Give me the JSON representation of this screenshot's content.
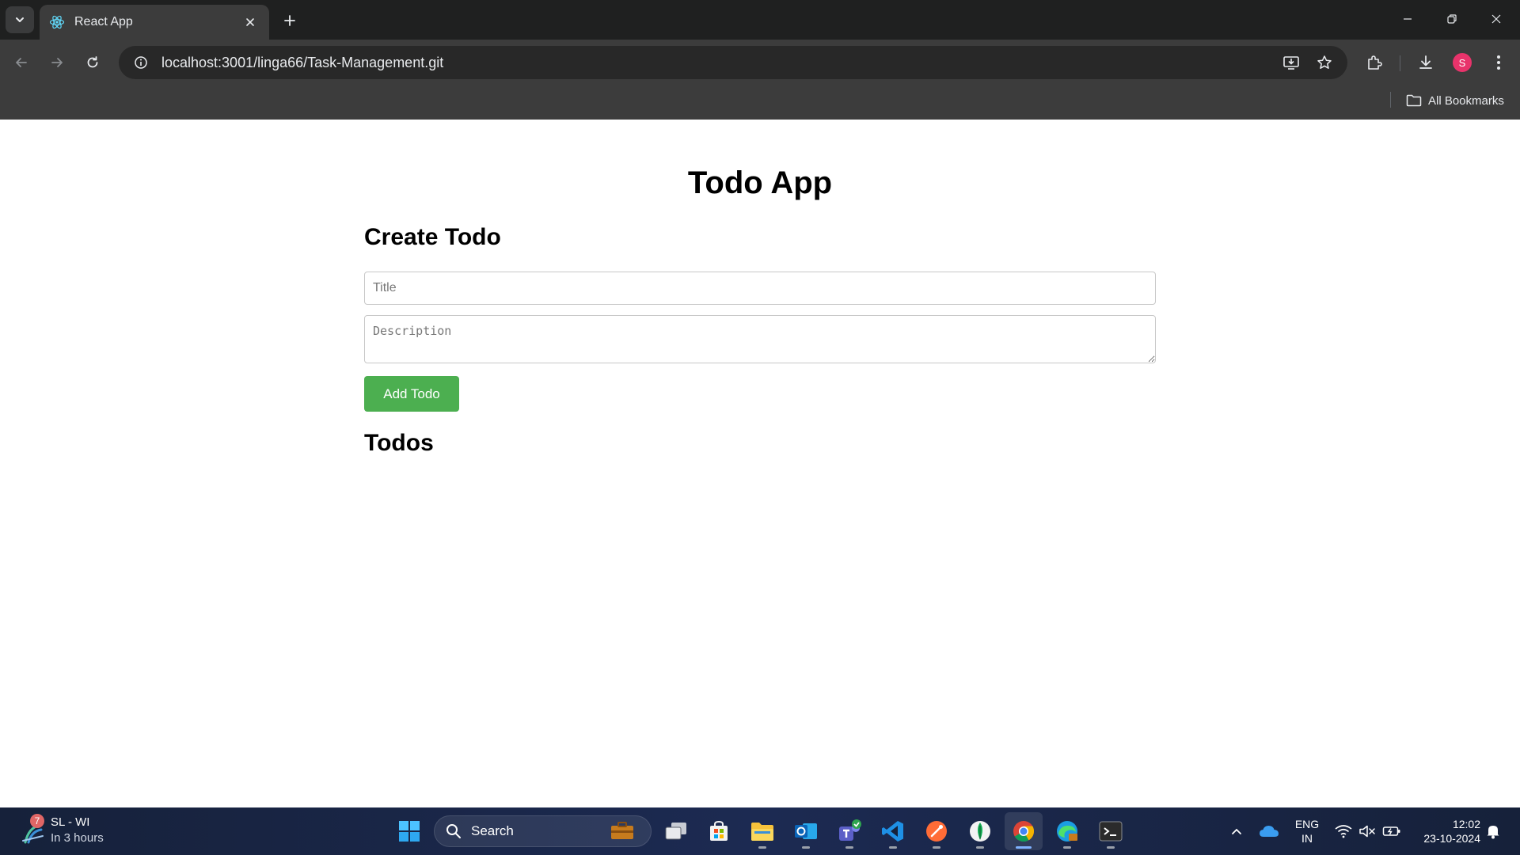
{
  "browser": {
    "tab": {
      "title": "React App"
    },
    "address": {
      "url": "localhost:3001/linga66/Task-Management.git"
    },
    "bookmarks": {
      "all_label": "All Bookmarks"
    },
    "profile_initial": "S"
  },
  "page": {
    "app_title": "Todo App",
    "create_heading": "Create Todo",
    "title_input": {
      "placeholder": "Title",
      "value": ""
    },
    "description_input": {
      "placeholder": "Description",
      "value": ""
    },
    "add_button": "Add Todo",
    "todos_heading": "Todos",
    "todos": []
  },
  "taskbar": {
    "weather": {
      "badge": "7",
      "title": "SL - WI",
      "subtitle": "In 3 hours"
    },
    "search_label": "Search",
    "pinned_apps": [
      "windows-start",
      "search",
      "work-briefcase",
      "task-view",
      "microsoft-store",
      "file-explorer",
      "outlook",
      "teams",
      "vscode",
      "postman",
      "mongodb-compass",
      "chrome",
      "edge",
      "terminal"
    ],
    "language": {
      "line1": "ENG",
      "line2": "IN"
    },
    "clock": {
      "time": "12:02",
      "date": "23-10-2024"
    }
  }
}
